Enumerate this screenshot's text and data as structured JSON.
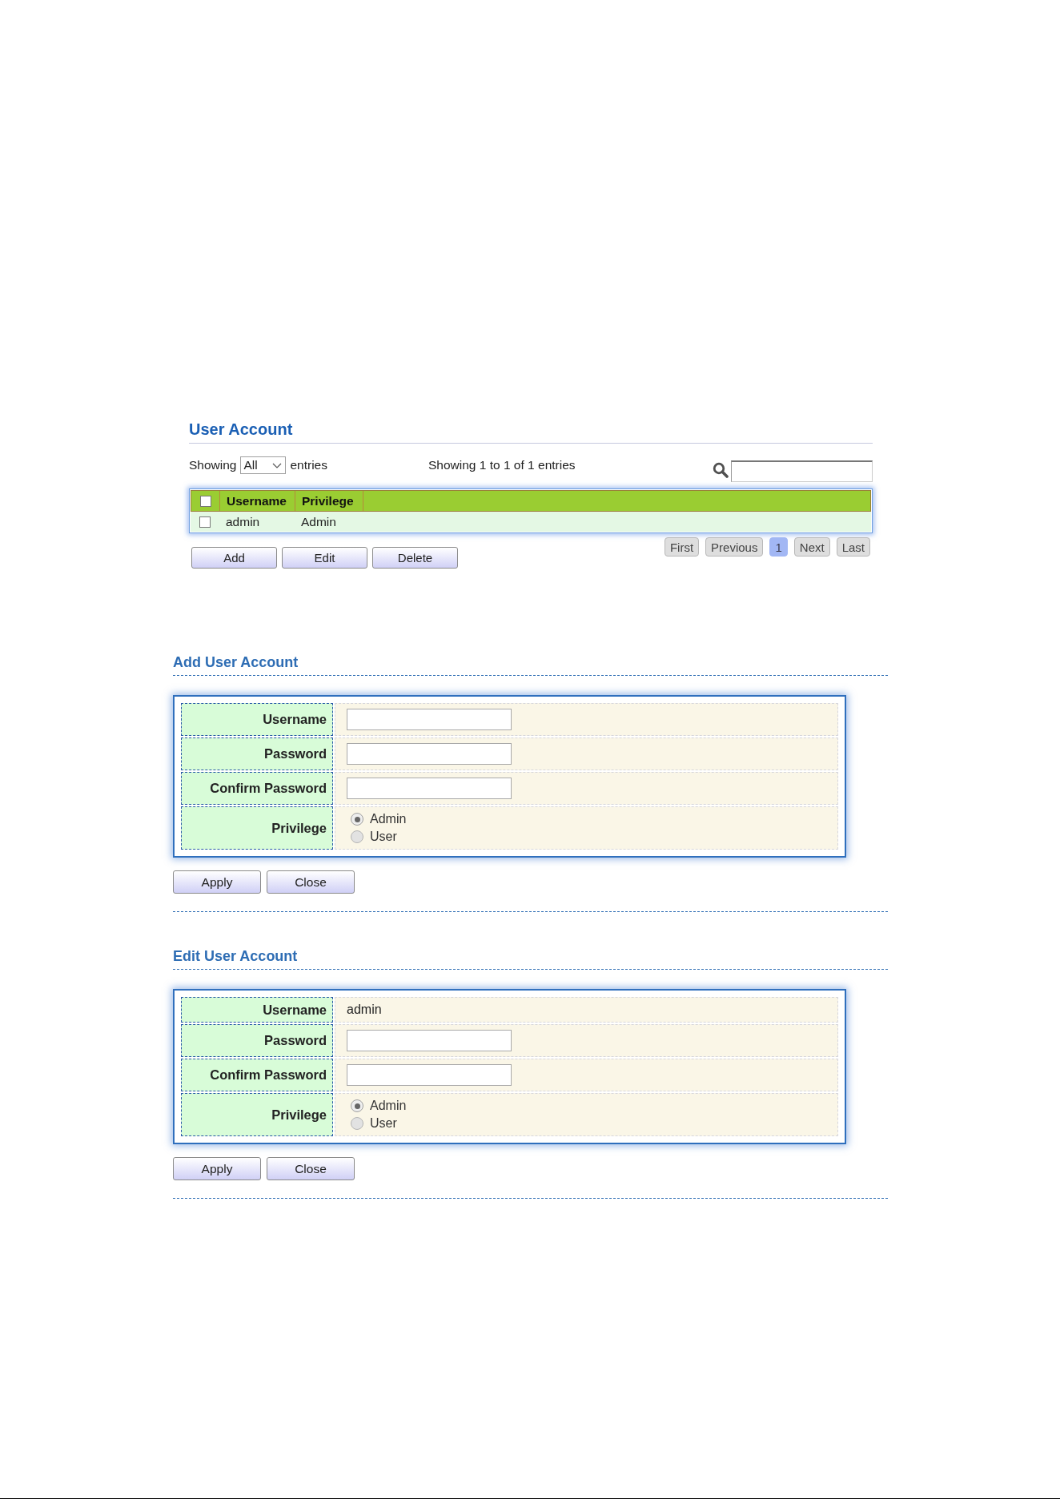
{
  "user_account": {
    "title": "User Account",
    "length_menu": {
      "prefix": "Showing",
      "value": "All",
      "suffix": "entries"
    },
    "info": "Showing 1 to 1 of 1 entries",
    "table": {
      "select_all_checked": false,
      "columns": [
        "Username",
        "Privilege"
      ],
      "rows": [
        {
          "checked": false,
          "cells": [
            "admin",
            "Admin"
          ]
        }
      ]
    },
    "buttons": [
      "Add",
      "Edit",
      "Delete"
    ],
    "pagination": [
      {
        "label": "First",
        "selected": false
      },
      {
        "label": "Previous",
        "selected": false
      },
      {
        "label": "1",
        "selected": true
      },
      {
        "label": "Next",
        "selected": false
      },
      {
        "label": "Last",
        "selected": false
      }
    ]
  },
  "add_user_account": {
    "title": "Add User Account",
    "fields": [
      {
        "kind": "input",
        "label": "Username"
      },
      {
        "kind": "input",
        "label": "Password"
      },
      {
        "kind": "input",
        "label": "Confirm Password"
      },
      {
        "kind": "radio",
        "label": "Privilege",
        "options": [
          {
            "label": "Admin",
            "selected": true
          },
          {
            "label": "User",
            "selected": false
          }
        ]
      }
    ],
    "buttons": [
      "Apply",
      "Close"
    ]
  },
  "edit_user_account": {
    "title": "Edit User Account",
    "fields": [
      {
        "kind": "text",
        "label": "Username",
        "value": "admin"
      },
      {
        "kind": "input",
        "label": "Password"
      },
      {
        "kind": "input",
        "label": "Confirm Password"
      },
      {
        "kind": "radio",
        "label": "Privilege",
        "options": [
          {
            "label": "Admin",
            "selected": true
          },
          {
            "label": "User",
            "selected": false
          }
        ]
      }
    ],
    "buttons": [
      "Apply",
      "Close"
    ]
  }
}
